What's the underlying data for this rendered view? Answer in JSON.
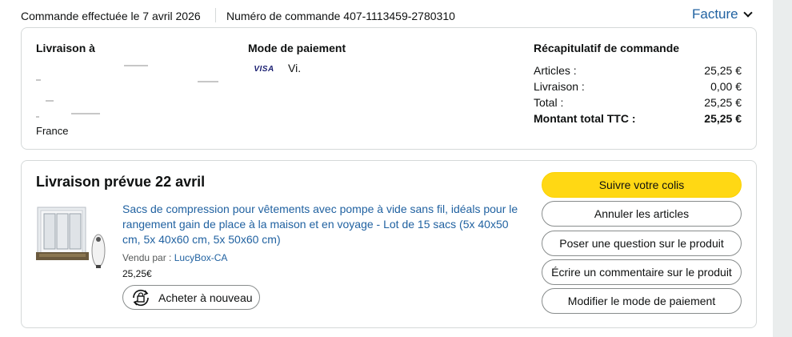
{
  "header": {
    "placed_text": "Commande effectuée le 7 avril 2026",
    "order_number_text": "Numéro de commande 407-1113459-2780310",
    "invoice_label": "Facture"
  },
  "shipping": {
    "title": "Livraison à",
    "visible_lines": [
      "France"
    ]
  },
  "payment": {
    "title": "Mode de paiement",
    "card_brand": "VISA",
    "card_text": "Vi."
  },
  "summary": {
    "title": "Récapitulatif de commande",
    "rows": [
      {
        "label": "Articles :",
        "value": "25,25 €"
      },
      {
        "label": "Livraison :",
        "value": "0,00 €"
      },
      {
        "label": "Total :",
        "value": "25,25 €"
      },
      {
        "label": "Montant total TTC :",
        "value": "25,25 €"
      }
    ]
  },
  "delivery": {
    "title": "Livraison prévue 22 avril",
    "product": {
      "title": "Sacs de compression pour vêtements avec pompe à vide sans fil, idéals pour le rangement gain de place à la maison et en voyage - Lot de 15 sacs (5x 40x50 cm, 5x 40x60 cm, 5x 50x60 cm)",
      "sold_by_label": "Vendu par  :",
      "seller": "LucyBox-CA",
      "price": "25,25€",
      "buy_again_label": "Acheter à nouveau"
    },
    "actions": [
      "Suivre votre colis",
      "Annuler les articles",
      "Poser une question sur le produit",
      "Écrire un commentaire sur le produit",
      "Modifier le mode de paiement"
    ]
  },
  "colors": {
    "link": "#2162a1",
    "primary_button": "#ffd814",
    "border": "#d5d9d9"
  },
  "icons": [
    "chevron-down-icon",
    "visa-logo-icon",
    "buy-again-icon",
    "product-image"
  ]
}
